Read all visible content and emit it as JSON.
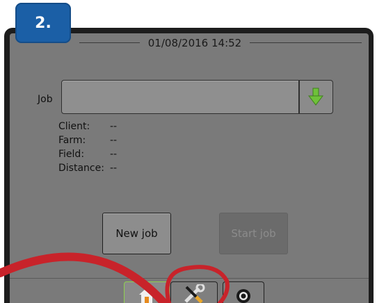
{
  "step_badge": "2.",
  "header": {
    "datetime": "01/08/2016 14:52"
  },
  "job": {
    "label": "Job",
    "value": "",
    "dropdown_icon": "down-arrow-icon"
  },
  "info": {
    "rows": [
      {
        "key": "Client:",
        "value": "--"
      },
      {
        "key": "Farm:",
        "value": "--"
      },
      {
        "key": "Field:",
        "value": "--"
      },
      {
        "key": "Distance:",
        "value": "--"
      }
    ]
  },
  "buttons": {
    "new_job": "New job",
    "start_job": "Start job"
  },
  "tabs": [
    {
      "name": "home",
      "icon": "home-icon",
      "active": true
    },
    {
      "name": "tools",
      "icon": "wrench-screwdriver-icon",
      "highlighted": true
    },
    {
      "name": "camera",
      "icon": "camera-icon"
    }
  ],
  "colors": {
    "accent_green": "#8fd14f",
    "badge_blue": "#1b5fa6",
    "annotation_red": "#c8232a"
  }
}
